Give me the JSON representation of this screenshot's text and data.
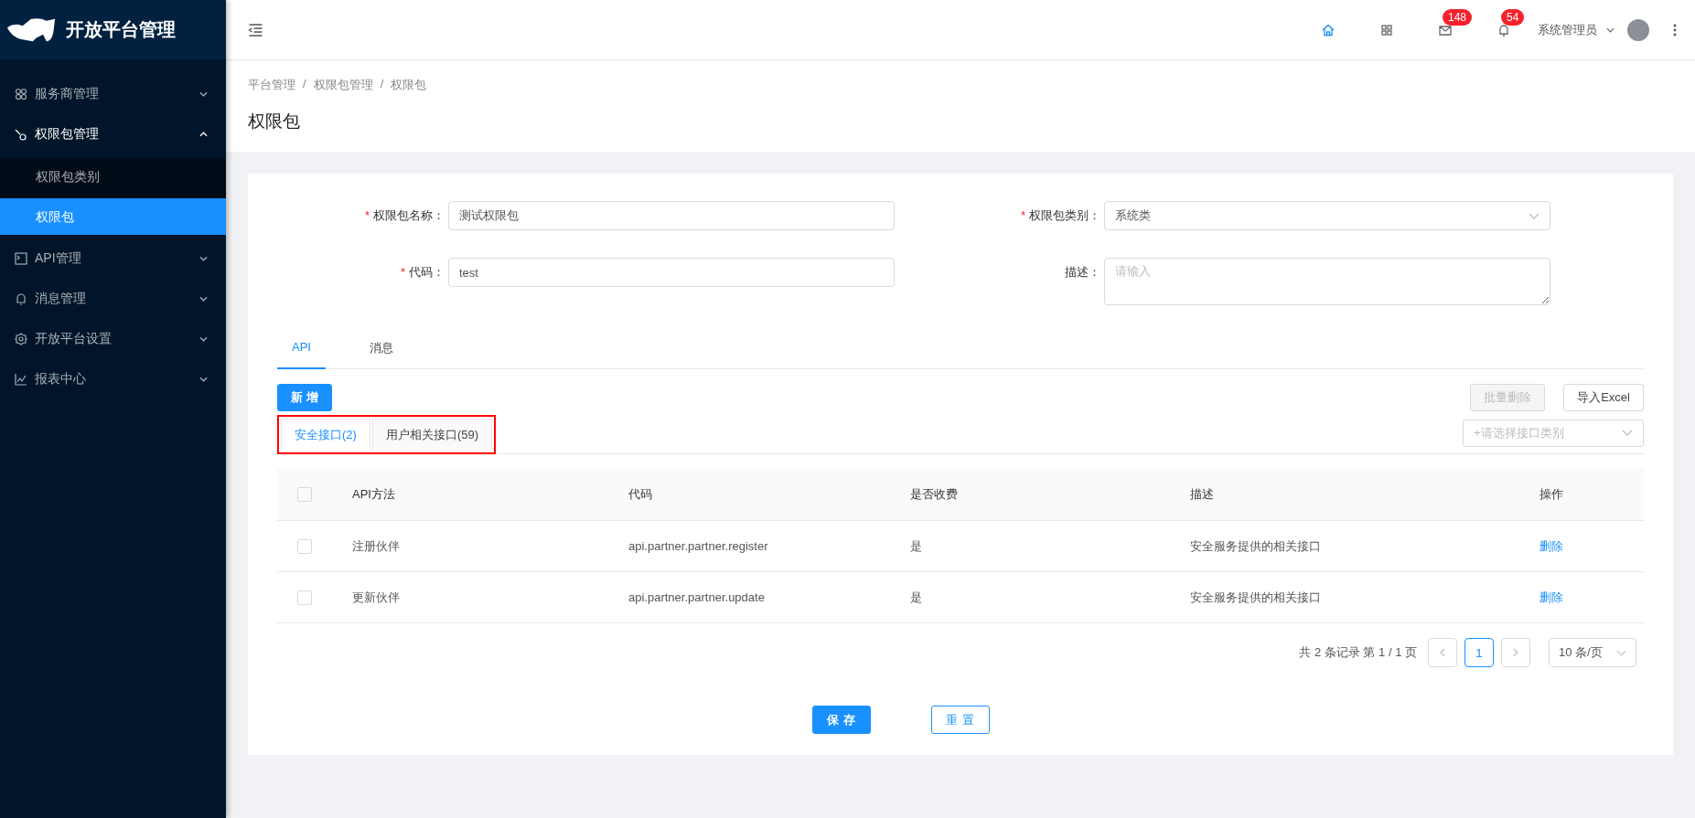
{
  "sidebar": {
    "logo_title": "开放平台管理",
    "items": [
      {
        "label": "服务商管理",
        "expanded": false
      },
      {
        "label": "权限包管理",
        "expanded": true,
        "children": [
          {
            "label": "权限包类别",
            "selected": false
          },
          {
            "label": "权限包",
            "selected": true
          }
        ]
      },
      {
        "label": "API管理",
        "expanded": false
      },
      {
        "label": "消息管理",
        "expanded": false
      },
      {
        "label": "开放平台设置",
        "expanded": false
      },
      {
        "label": "报表中心",
        "expanded": false
      }
    ]
  },
  "header": {
    "icons": [
      {
        "kind": "home",
        "selected": true
      },
      {
        "kind": "apps",
        "selected": false
      },
      {
        "kind": "mail",
        "selected": false,
        "badge": "148"
      },
      {
        "kind": "bell",
        "selected": false,
        "badge": "54"
      }
    ],
    "user": "系统管理员"
  },
  "breadcrumb": [
    {
      "label": "平台管理"
    },
    {
      "separator": "/",
      "label": "权限包管理"
    },
    {
      "separator": "/",
      "label": "权限包"
    }
  ],
  "page_title": "权限包",
  "form": {
    "fields": [
      {
        "label": "权限包名称：",
        "required_mark": "*",
        "kind": "input",
        "value": "测试权限包"
      },
      {
        "label": "权限包类别：",
        "required_mark": "*",
        "kind": "select",
        "value": "系统类"
      },
      {
        "label": "代码：",
        "required_mark": "*",
        "kind": "input",
        "value": "test"
      },
      {
        "label": "描述：",
        "kind": "textarea",
        "placeholder": "请输入"
      }
    ]
  },
  "tabs": [
    {
      "label": "API",
      "selected": true
    },
    {
      "label": "消息",
      "selected": false
    }
  ],
  "toolbar": {
    "add": "新 增",
    "batch_delete": {
      "label": "批量删除",
      "disabled": true
    },
    "import": "导入Excel"
  },
  "sub_tabs": [
    {
      "label": "安全接口(2)",
      "selected": true
    },
    {
      "label": "用户相关接口(59)",
      "selected": false
    }
  ],
  "category_select": {
    "placeholder": "+请选择接口类别"
  },
  "table": {
    "header_checked": false,
    "columns": [
      "API方法",
      "代码",
      "是否收费",
      "描述",
      "操作"
    ],
    "rows": [
      {
        "checked": false,
        "cells": [
          "注册伙伴",
          "api.partner.partner.register",
          "是",
          "安全服务提供的相关接口"
        ],
        "action": "删除"
      },
      {
        "checked": false,
        "cells": [
          "更新伙伴",
          "api.partner.partner.update",
          "是",
          "安全服务提供的相关接口"
        ],
        "action": "删除"
      }
    ]
  },
  "pagination": {
    "summary": "共 2 条记录 第 1 / 1 页",
    "pages": [
      {
        "label": "1",
        "selected": true
      }
    ],
    "page_size": "10 条/页"
  },
  "footer": {
    "save": "保 存",
    "reset": "重 置"
  }
}
